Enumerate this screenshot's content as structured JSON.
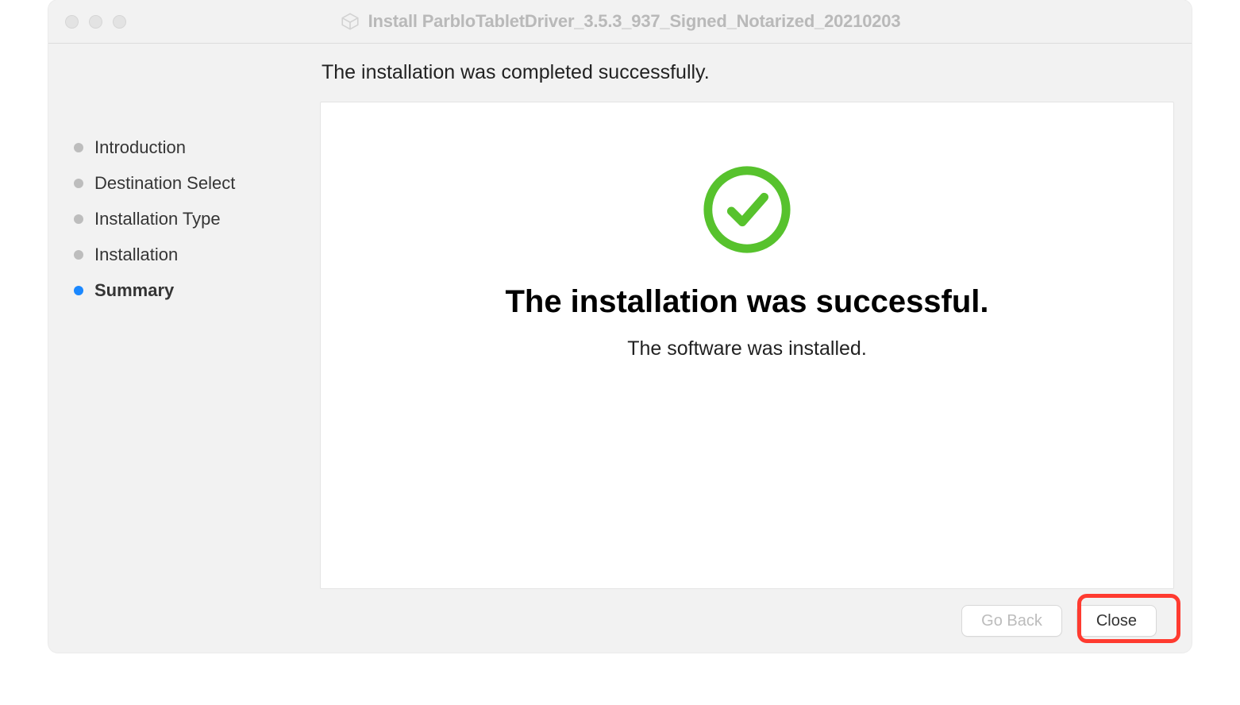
{
  "window": {
    "title": "Install ParbloTabletDriver_3.5.3_937_Signed_Notarized_20210203"
  },
  "sidebar": {
    "steps": [
      {
        "label": "Introduction",
        "active": false
      },
      {
        "label": "Destination Select",
        "active": false
      },
      {
        "label": "Installation Type",
        "active": false
      },
      {
        "label": "Installation",
        "active": false
      },
      {
        "label": "Summary",
        "active": true
      }
    ]
  },
  "main": {
    "heading": "The installation was completed successfully.",
    "success_title": "The installation was successful.",
    "success_sub": "The software was installed."
  },
  "footer": {
    "go_back_label": "Go Back",
    "close_label": "Close"
  }
}
